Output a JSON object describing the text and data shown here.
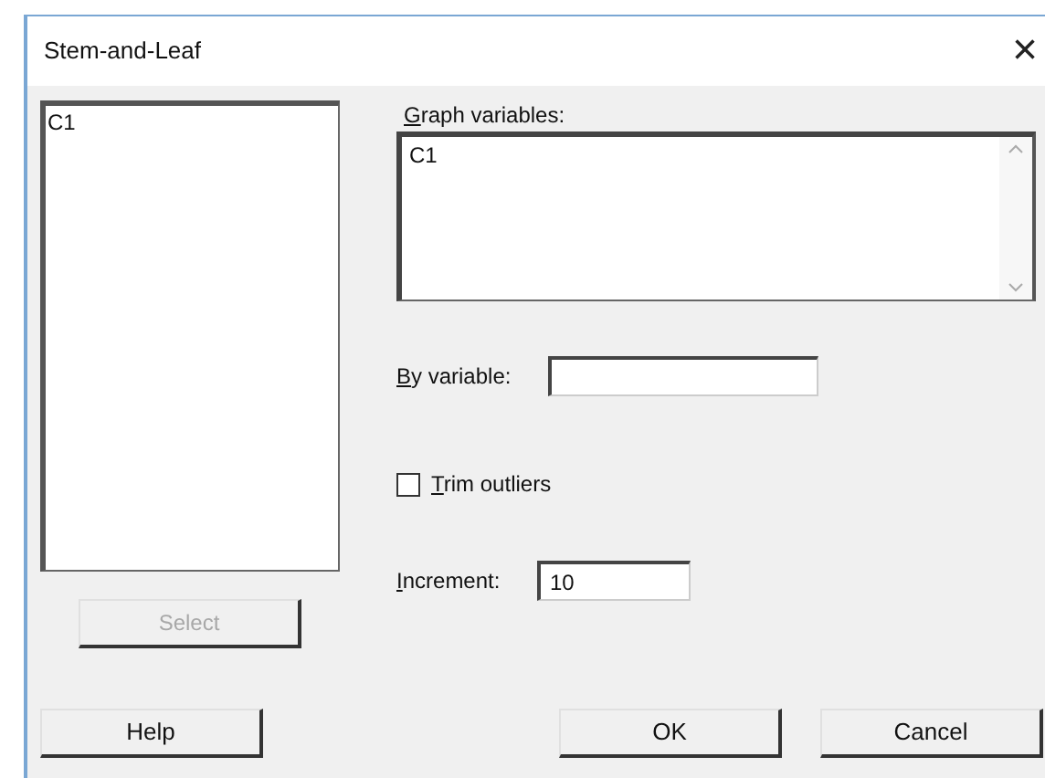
{
  "window": {
    "title": "Stem-and-Leaf",
    "close": "×"
  },
  "variable_list": {
    "items": [
      "C1"
    ]
  },
  "select_button": {
    "label": "Select",
    "disabled": true
  },
  "graph_variables": {
    "label": "Graph variables:",
    "value": "C1"
  },
  "by_variable": {
    "label": "By variable:"
  },
  "trim_outliers": {
    "label": "Trim outliers",
    "checked": false
  },
  "increment": {
    "label": "Increment:",
    "value": "10"
  },
  "buttons": [
    {
      "label": "Help",
      "kind": "left"
    },
    {
      "label": "OK",
      "kind": "right"
    },
    {
      "label": "Cancel",
      "kind": "right"
    }
  ]
}
